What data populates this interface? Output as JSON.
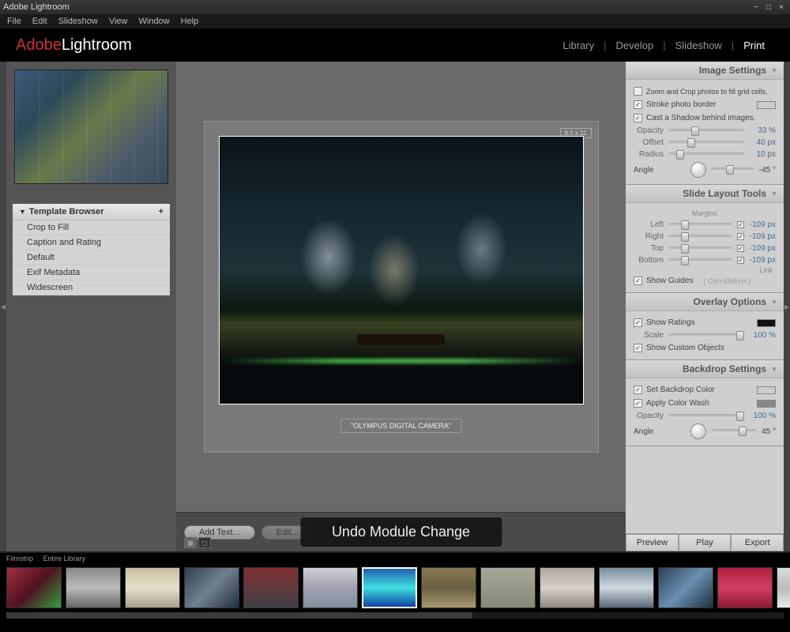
{
  "titlebar": {
    "title": "Adobe Lightroom"
  },
  "menubar": [
    "File",
    "Edit",
    "Slideshow",
    "View",
    "Window",
    "Help"
  ],
  "brand": {
    "adobe": "Adobe",
    "product": "Lightroom"
  },
  "modules": {
    "items": [
      "Library",
      "Develop",
      "Slideshow",
      "Print"
    ],
    "active": "Print"
  },
  "left": {
    "template_browser": {
      "title": "Template Browser",
      "items": [
        "Crop to Fill",
        "Caption and Rating",
        "Default",
        "Exif Metadata",
        "Widescreen"
      ]
    }
  },
  "center": {
    "page_size_label": "8.5 x 11",
    "caption": "\"OLYMPUS DIGITAL CAMERA\"",
    "add_text": "Add Text...",
    "edit": "Edit...",
    "toast": "Undo Module Change"
  },
  "right": {
    "image_settings": {
      "title": "Image Settings",
      "zoom_crop": "Zoom and Crop photos to fill grid cells.",
      "stroke": "Stroke photo border",
      "shadow": "Cast a Shadow behind images.",
      "opacity": {
        "label": "Opacity",
        "value": "33 %"
      },
      "offset": {
        "label": "Offset",
        "value": "40 px"
      },
      "radius": {
        "label": "Radius",
        "value": "10 px"
      },
      "angle": {
        "label": "Angle",
        "value": "-45 °"
      }
    },
    "slide_layout": {
      "title": "Slide Layout Tools",
      "margins": "Margins",
      "left": {
        "label": "Left",
        "value": "-109 px"
      },
      "right": {
        "label": "Right",
        "value": "-109 px"
      },
      "top": {
        "label": "Top",
        "value": "-109 px"
      },
      "bottom": {
        "label": "Bottom",
        "value": "-109 px"
      },
      "link": "Link",
      "guides": "Show Guides",
      "guides_hint": "( Ctrl+Shift+H )"
    },
    "overlay": {
      "title": "Overlay Options",
      "ratings": "Show Ratings",
      "scale": {
        "label": "Scale",
        "value": "100 %"
      },
      "custom": "Show Custom Objects"
    },
    "backdrop": {
      "title": "Backdrop Settings",
      "color": "Set Backdrop Color",
      "wash": "Apply Color Wash",
      "opacity": {
        "label": "Opacity",
        "value": "100 %"
      },
      "angle": {
        "label": "Angle",
        "value": "45 °"
      }
    },
    "actions": {
      "preview": "Preview",
      "play": "Play",
      "export": "Export"
    }
  },
  "filmstrip": {
    "label": "Filmstrip",
    "source": "Entire Library"
  }
}
